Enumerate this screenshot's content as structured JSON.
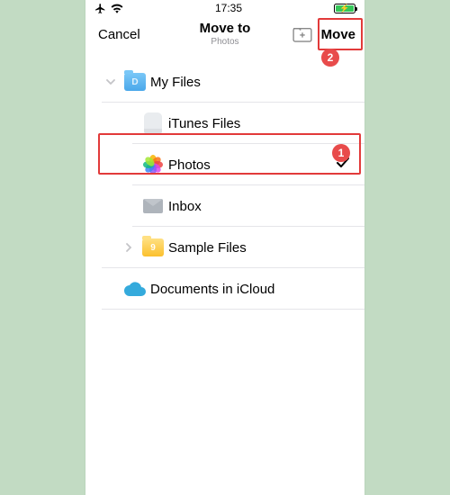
{
  "status": {
    "time": "17:35"
  },
  "nav": {
    "cancel": "Cancel",
    "title": "Move to",
    "subtitle": "Photos",
    "move": "Move"
  },
  "callouts": {
    "photos_badge": "1",
    "move_badge": "2"
  },
  "rows": {
    "my_files": "My Files",
    "itunes": "iTunes Files",
    "photos": "Photos",
    "inbox": "Inbox",
    "sample": "Sample Files",
    "icloud": "Documents in iCloud"
  }
}
